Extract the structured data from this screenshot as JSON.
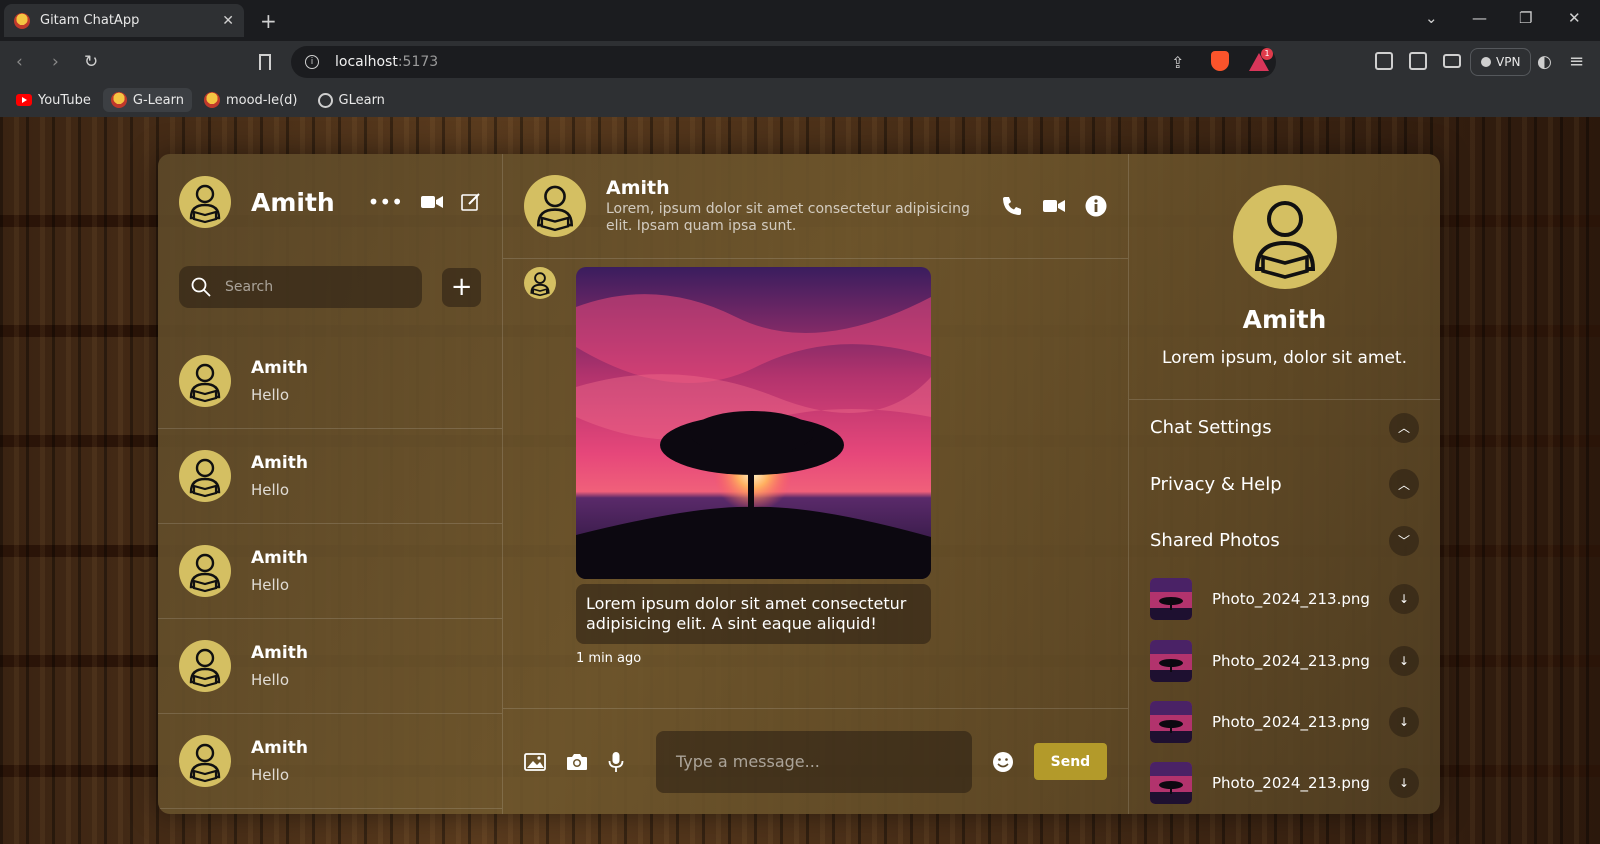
{
  "browser": {
    "tab_title": "Gitam ChatApp",
    "url_host": "localhost",
    "url_port": ":5173",
    "rewards_count": "1",
    "vpn_label": "VPN",
    "bookmarks": [
      "YouTube",
      "G-Learn",
      "mood-le(d)",
      "GLearn"
    ]
  },
  "sidebar": {
    "user_name": "Amith",
    "search_placeholder": "Search",
    "conversations": [
      {
        "name": "Amith",
        "last_message": "Hello"
      },
      {
        "name": "Amith",
        "last_message": "Hello"
      },
      {
        "name": "Amith",
        "last_message": "Hello"
      },
      {
        "name": "Amith",
        "last_message": "Hello"
      },
      {
        "name": "Amith",
        "last_message": "Hello"
      }
    ]
  },
  "chat": {
    "contact_name": "Amith",
    "contact_status": "Lorem, ipsum dolor sit amet consectetur adipisicing elit. Ipsam quam ipsa sunt.",
    "message_text": "Lorem ipsum dolor sit amet consectetur adipisicing elit. A sint eaque aliquid!",
    "message_time": "1 min ago",
    "input_placeholder": "Type a message...",
    "send_label": "Send"
  },
  "details": {
    "name": "Amith",
    "bio": "Lorem ipsum, dolor sit amet.",
    "sections": [
      "Chat Settings",
      "Privacy & Help",
      "Shared Photos"
    ],
    "shared_photos": [
      "Photo_2024_213.png",
      "Photo_2024_213.png",
      "Photo_2024_213.png",
      "Photo_2024_213.png"
    ]
  },
  "colors": {
    "avatar_bg": "#d4bf62",
    "send_button": "#b39a2a"
  }
}
